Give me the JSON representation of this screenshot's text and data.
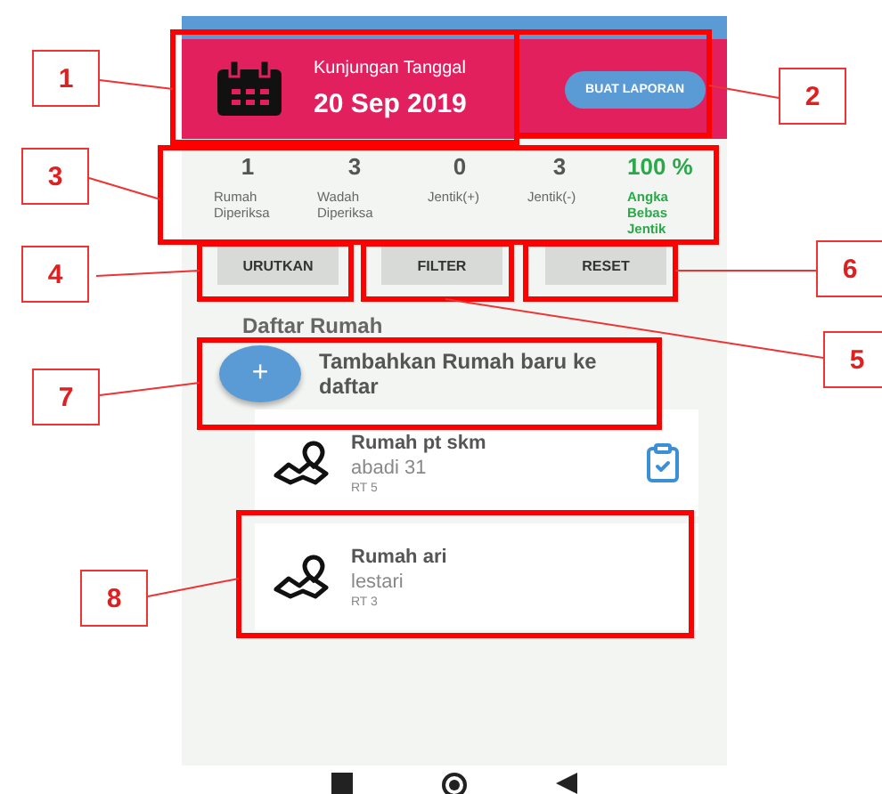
{
  "header": {
    "caption": "Kunjungan Tanggal",
    "date": "20 Sep 2019",
    "button": "BUAT LAPORAN"
  },
  "stats": [
    {
      "value": "1",
      "label": "Rumah Diperiksa",
      "kind": "count"
    },
    {
      "value": "3",
      "label": "Wadah Diperiksa",
      "kind": "count"
    },
    {
      "value": "0",
      "label": "Jentik(+)",
      "kind": "count"
    },
    {
      "value": "3",
      "label": "Jentik(-)",
      "kind": "count"
    },
    {
      "value": "100 %",
      "label": "Angka Bebas Jentik",
      "kind": "percent"
    }
  ],
  "actions": [
    "URUTKAN",
    "FILTER",
    "RESET"
  ],
  "list_title": "Daftar Rumah",
  "add_item": {
    "icon": "+",
    "label": "Tambahkan Rumah baru ke daftar"
  },
  "houses": [
    {
      "name": "Rumah pt skm",
      "street": "abadi 31",
      "rt": "RT 5",
      "reported": true
    },
    {
      "name": "Rumah ari",
      "street": "lestari",
      "rt": "RT 3",
      "reported": false
    }
  ],
  "callouts": [
    "1",
    "2",
    "3",
    "4",
    "5",
    "6",
    "7",
    "8"
  ]
}
